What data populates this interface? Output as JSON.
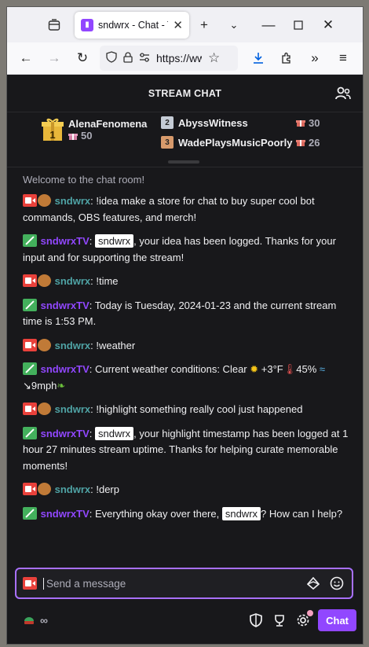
{
  "browser": {
    "tab_title": "sndwrx - Chat - Twitch",
    "url": "https://www",
    "colors": {
      "chrome_bg": "#f0f0f4",
      "accent": "#0060df"
    }
  },
  "chat": {
    "header_title": "STREAM CHAT",
    "leaderboard": {
      "first": {
        "rank": "1",
        "name": "AlenaFenomena",
        "points": "50"
      },
      "second": {
        "rank": "2",
        "name": "AbyssWitness",
        "points": "30"
      },
      "third": {
        "rank": "3",
        "name": "WadePlaysMusicPoorly",
        "points": "26"
      }
    },
    "welcome": "Welcome to the chat room!",
    "messages": [
      {
        "user": "sndwrx",
        "type": "viewer",
        "text": ": !idea make a store for chat to buy super cool bot commands, OBS features, and merch!"
      },
      {
        "user": "sndwrxTV",
        "type": "bot",
        "mention": "sndwrx",
        "text": ", your idea has been logged. Thanks for your input and for supporting the stream!"
      },
      {
        "user": "sndwrx",
        "type": "viewer",
        "text": ": !time"
      },
      {
        "user": "sndwrxTV",
        "type": "bot",
        "text": ": Today is Tuesday, 2024-01-23 and the current stream time is 1:53 PM."
      },
      {
        "user": "sndwrx",
        "type": "viewer",
        "text": ": !weather"
      },
      {
        "user": "sndwrxTV",
        "type": "bot",
        "text_a": ": Current weather conditions: Clear ",
        "text_b": " +3°F",
        "text_c": "45% ",
        "text_d": " ↘9mph"
      },
      {
        "user": "sndwrx",
        "type": "viewer",
        "text": ": !highlight something really cool just happened"
      },
      {
        "user": "sndwrxTV",
        "type": "bot",
        "mention": "sndwrx",
        "text": ", your highlight timestamp has been logged at 1 hour 27 minutes stream uptime. Thanks for helping curate memorable moments!"
      },
      {
        "user": "sndwrx",
        "type": "viewer",
        "text": ": !derp"
      },
      {
        "user": "sndwrxTV",
        "type": "bot",
        "text_a": ": Everything okay over there, ",
        "mention": "sndwrx",
        "text_b": "? How can I help?"
      }
    ],
    "input_placeholder": "Send a message",
    "channel_points": "∞",
    "chat_button": "Chat",
    "colors": {
      "bg": "#18181b",
      "viewer_name": "#4fa3a5",
      "bot_name": "#9147ff",
      "accent": "#9147ff"
    }
  }
}
